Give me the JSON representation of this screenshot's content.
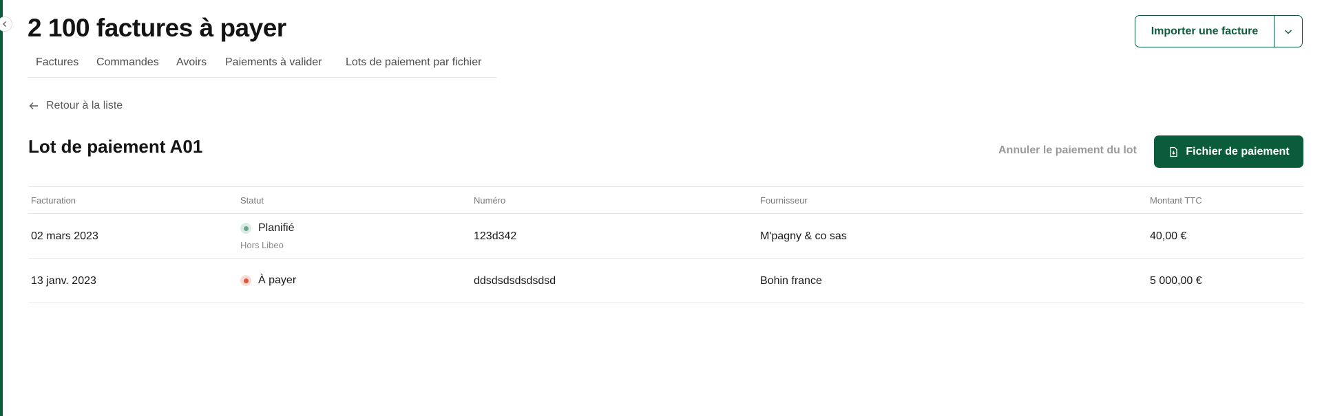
{
  "header": {
    "title": "2 100 factures à payer",
    "import_button_label": "Importer une facture"
  },
  "tabs": [
    {
      "label": "Factures"
    },
    {
      "label": "Commandes"
    },
    {
      "label": "Avoirs"
    },
    {
      "label": "Paiements à valider"
    },
    {
      "label": "Lots de paiement par fichier"
    }
  ],
  "back_link": {
    "label": "Retour à la liste"
  },
  "lot": {
    "title": "Lot de paiement A01",
    "cancel_label": "Annuler le paiement du lot",
    "file_button_label": "Fichier de paiement"
  },
  "table": {
    "columns": [
      "Facturation",
      "Statut",
      "Numéro",
      "Fournisseur",
      "Montant TTC"
    ],
    "rows": [
      {
        "date": "02 mars 2023",
        "status": "Planifié",
        "status_sub": "Hors Libeo",
        "status_color": "#6aa58a",
        "status_bg": "#dcece4",
        "number": "123d342",
        "supplier": "M'pagny & co sas",
        "amount": "40,00 €"
      },
      {
        "date": "13 janv. 2023",
        "status": "À payer",
        "status_color": "#e2553d",
        "status_bg": "#fbdcd5",
        "number": "ddsdsdsdsdsdsd",
        "supplier": "Bohin france",
        "amount": "5 000,00 €"
      }
    ]
  },
  "colors": {
    "brand": "#0b5c3b"
  }
}
